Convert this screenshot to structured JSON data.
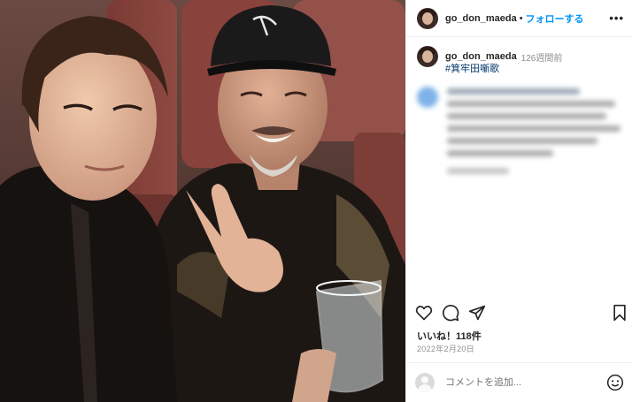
{
  "post": {
    "username": "go_don_maeda",
    "follow_label": "フォローする",
    "separator": "•",
    "more_label": "•••"
  },
  "caption": {
    "username": "go_don_maeda",
    "time_ago": "126週間前",
    "hashtag": "#箕牢田噺歌"
  },
  "stats": {
    "likes": "いいね！118件",
    "date": "2022年2月20日"
  },
  "comment": {
    "placeholder": "コメントを追加..."
  },
  "icons": {
    "like": "heart-icon",
    "comment": "comment-icon",
    "share": "send-icon",
    "save": "bookmark-icon",
    "emoji": "smiley-icon",
    "more": "more-icon"
  },
  "colors": {
    "link_blue": "#0095f6",
    "hashtag_blue": "#00376b",
    "muted": "#8e8e8e",
    "text": "#262626"
  }
}
